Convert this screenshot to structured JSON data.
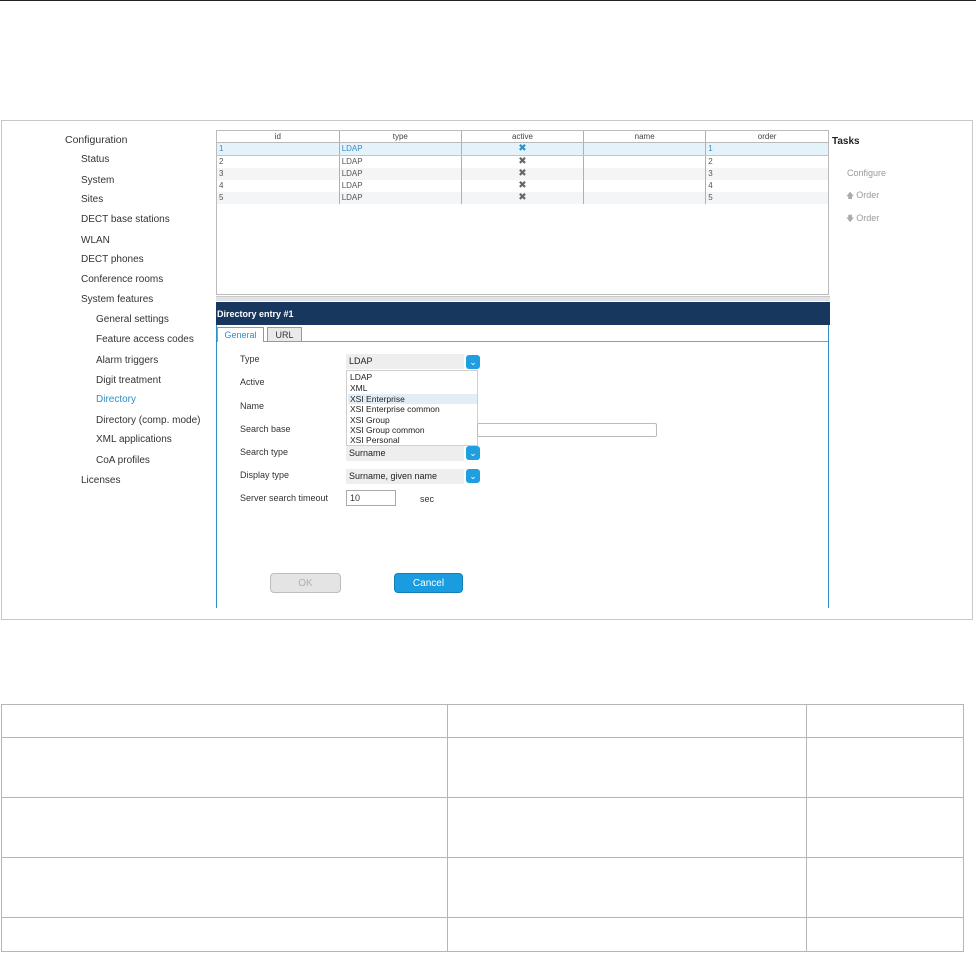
{
  "nav": {
    "root": "Configuration",
    "items": [
      {
        "label": "Status"
      },
      {
        "label": "System"
      },
      {
        "label": "Sites"
      },
      {
        "label": "DECT base stations"
      },
      {
        "label": "WLAN"
      },
      {
        "label": "DECT phones"
      },
      {
        "label": "Conference rooms"
      },
      {
        "label": "System features"
      }
    ],
    "sub_items": [
      {
        "label": "General settings"
      },
      {
        "label": "Feature access codes"
      },
      {
        "label": "Alarm triggers"
      },
      {
        "label": "Digit treatment"
      },
      {
        "label": "Directory"
      },
      {
        "label": "Directory (comp. mode)"
      },
      {
        "label": "XML applications"
      },
      {
        "label": "CoA profiles"
      }
    ],
    "last_item": "Licenses",
    "active_item": "Directory"
  },
  "grid": {
    "columns": [
      "id",
      "type",
      "active",
      "name",
      "order"
    ],
    "rows": [
      {
        "id": "1",
        "type": "LDAP",
        "active": "✖",
        "name": "",
        "order": "1"
      },
      {
        "id": "2",
        "type": "LDAP",
        "active": "✖",
        "name": "",
        "order": "2"
      },
      {
        "id": "3",
        "type": "LDAP",
        "active": "✖",
        "name": "",
        "order": "3"
      },
      {
        "id": "4",
        "type": "LDAP",
        "active": "✖",
        "name": "",
        "order": "4"
      },
      {
        "id": "5",
        "type": "LDAP",
        "active": "✖",
        "name": "",
        "order": "5"
      }
    ],
    "selected_row": 0
  },
  "tasks": {
    "title": "Tasks",
    "items": [
      {
        "label": "Configure",
        "icon": ""
      },
      {
        "label": "Order",
        "icon": "arrow-up-icon"
      },
      {
        "label": "Order",
        "icon": "arrow-down-icon"
      }
    ]
  },
  "dialog": {
    "title": "Directory entry #1",
    "tabs": [
      "General",
      "URL"
    ],
    "active_tab": "General",
    "fields": {
      "type_label": "Type",
      "type_value": "LDAP",
      "active_label": "Active",
      "name_label": "Name",
      "search_base_label": "Search base",
      "search_type_label": "Search type",
      "search_type_value": "Surname",
      "display_type_label": "Display type",
      "display_type_value": "Surname, given name",
      "timeout_label": "Server search timeout",
      "timeout_value": "10",
      "timeout_unit": "sec"
    },
    "type_options": [
      "LDAP",
      "XML",
      "XSI Enterprise",
      "XSI Enterprise common",
      "XSI Group",
      "XSI Group common",
      "XSI Personal"
    ],
    "highlighted_option": "XSI Enterprise",
    "ok_label": "OK",
    "cancel_label": "Cancel"
  },
  "colors": {
    "accent": "#1a9de0",
    "link": "#2f8fc8",
    "title_bar": "#17375e"
  }
}
